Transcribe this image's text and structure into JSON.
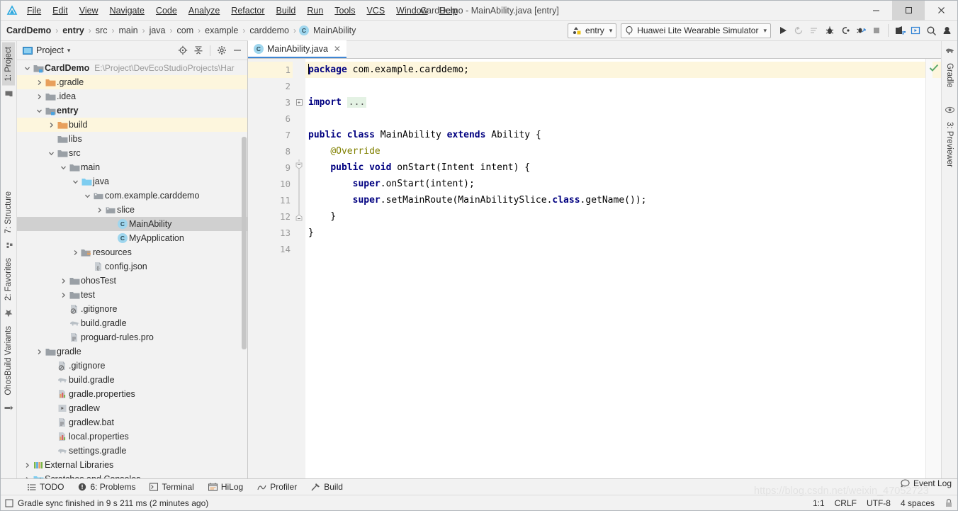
{
  "window": {
    "title": "CardDemo - MainAbility.java [entry]",
    "minimize": "—",
    "maximize": "☐",
    "close": "✕"
  },
  "menubar": [
    {
      "label": "File"
    },
    {
      "label": "Edit"
    },
    {
      "label": "View"
    },
    {
      "label": "Navigate"
    },
    {
      "label": "Code"
    },
    {
      "label": "Analyze"
    },
    {
      "label": "Refactor"
    },
    {
      "label": "Build"
    },
    {
      "label": "Run"
    },
    {
      "label": "Tools"
    },
    {
      "label": "VCS"
    },
    {
      "label": "Window"
    },
    {
      "label": "Help"
    }
  ],
  "breadcrumb": {
    "items": [
      {
        "label": "CardDemo",
        "bold": true
      },
      {
        "label": "entry",
        "bold": true
      },
      {
        "label": "src",
        "bold": false
      },
      {
        "label": "main",
        "bold": false
      },
      {
        "label": "java",
        "bold": false
      },
      {
        "label": "com",
        "bold": false
      },
      {
        "label": "example",
        "bold": false
      },
      {
        "label": "carddemo",
        "bold": false
      },
      {
        "label": "MainAbility",
        "bold": false,
        "icon": "class-icon",
        "icon_text": "C"
      }
    ],
    "separator": "›"
  },
  "toolbar": {
    "module_selector": "entry",
    "device_selector": "Huawei Lite Wearable Simulator",
    "caret": "▾",
    "buttons": [
      {
        "name": "run-button",
        "title": "Run"
      },
      {
        "name": "rerun-button",
        "title": "Rerun"
      },
      {
        "name": "run-with-coverage-button",
        "title": "Run with Coverage"
      },
      {
        "name": "debug-button",
        "title": "Debug"
      },
      {
        "name": "attach-debugger-button",
        "title": "Attach Debugger"
      },
      {
        "name": "profile-button",
        "title": "Profile"
      },
      {
        "name": "stop-button",
        "title": "Stop"
      },
      {
        "name": "device-manager-button",
        "title": "Device Manager"
      },
      {
        "name": "sdk-manager-button",
        "title": "SDK Manager"
      },
      {
        "name": "search-everywhere-icon",
        "title": "Search Everywhere"
      },
      {
        "name": "account-icon",
        "title": "Account"
      }
    ]
  },
  "left_strip": [
    {
      "label": "1: Project",
      "active": true,
      "icon": "project-folder-icon"
    },
    {
      "label": "7: Structure",
      "active": false,
      "icon": "structure-icon"
    },
    {
      "label": "2: Favorites",
      "active": false,
      "icon": "star-icon"
    },
    {
      "label": "OhosBuild Variants",
      "active": false,
      "icon": "variants-icon"
    }
  ],
  "right_strip": [
    {
      "label": "Gradle",
      "icon": "gradle-elephant-icon"
    },
    {
      "label": "3: Previewer",
      "icon": "eye-icon"
    }
  ],
  "project_panel": {
    "title": "Project",
    "title_caret": "▾",
    "actions": [
      {
        "name": "locate-file-icon",
        "title": "Select Opened File"
      },
      {
        "name": "collapse-all-icon",
        "title": "Collapse All"
      },
      {
        "name": "gear-icon",
        "title": "Settings"
      },
      {
        "name": "hide-panel-icon",
        "title": "Hide"
      }
    ],
    "tree": [
      {
        "indent": 0,
        "arrow": "down",
        "icon": "module-folder-icon",
        "label": "CardDemo",
        "bold": true,
        "subpath": "E:\\Project\\DevEcoStudioProjects\\Har",
        "selected": false,
        "highlight": false
      },
      {
        "indent": 1,
        "arrow": "right",
        "icon": "orange-folder-icon",
        "label": ".gradle",
        "bold": false,
        "subpath": "",
        "selected": false,
        "highlight": true
      },
      {
        "indent": 1,
        "arrow": "right",
        "icon": "gray-folder-icon",
        "label": ".idea",
        "bold": false,
        "subpath": "",
        "selected": false,
        "highlight": false
      },
      {
        "indent": 1,
        "arrow": "down",
        "icon": "module-folder-icon",
        "label": "entry",
        "bold": true,
        "subpath": "",
        "selected": false,
        "highlight": false
      },
      {
        "indent": 2,
        "arrow": "right",
        "icon": "orange-folder-icon",
        "label": "build",
        "bold": false,
        "subpath": "",
        "selected": false,
        "highlight": true
      },
      {
        "indent": 2,
        "arrow": "none",
        "icon": "gray-folder-icon",
        "label": "libs",
        "bold": false,
        "subpath": "",
        "selected": false,
        "highlight": false
      },
      {
        "indent": 2,
        "arrow": "down",
        "icon": "gray-folder-icon",
        "label": "src",
        "bold": false,
        "subpath": "",
        "selected": false,
        "highlight": false
      },
      {
        "indent": 3,
        "arrow": "down",
        "icon": "gray-folder-icon",
        "label": "main",
        "bold": false,
        "subpath": "",
        "selected": false,
        "highlight": false
      },
      {
        "indent": 4,
        "arrow": "down",
        "icon": "blue-source-folder-icon",
        "label": "java",
        "bold": false,
        "subpath": "",
        "selected": false,
        "highlight": false
      },
      {
        "indent": 5,
        "arrow": "down",
        "icon": "package-icon",
        "label": "com.example.carddemo",
        "bold": false,
        "subpath": "",
        "selected": false,
        "highlight": false
      },
      {
        "indent": 6,
        "arrow": "right",
        "icon": "package-icon",
        "label": "slice",
        "bold": false,
        "subpath": "",
        "selected": false,
        "highlight": false
      },
      {
        "indent": 7,
        "arrow": "none",
        "icon": "class-icon",
        "label": "MainAbility",
        "bold": false,
        "subpath": "",
        "selected": true,
        "highlight": false
      },
      {
        "indent": 7,
        "arrow": "none",
        "icon": "class-icon",
        "label": "MyApplication",
        "bold": false,
        "subpath": "",
        "selected": false,
        "highlight": false
      },
      {
        "indent": 4,
        "arrow": "right",
        "icon": "resources-folder-icon",
        "label": "resources",
        "bold": false,
        "subpath": "",
        "selected": false,
        "highlight": false
      },
      {
        "indent": 5,
        "arrow": "none",
        "icon": "json-file-icon",
        "label": "config.json",
        "bold": false,
        "subpath": "",
        "selected": false,
        "highlight": false
      },
      {
        "indent": 3,
        "arrow": "right",
        "icon": "gray-folder-icon",
        "label": "ohosTest",
        "bold": false,
        "subpath": "",
        "selected": false,
        "highlight": false
      },
      {
        "indent": 3,
        "arrow": "right",
        "icon": "gray-folder-icon",
        "label": "test",
        "bold": false,
        "subpath": "",
        "selected": false,
        "highlight": false
      },
      {
        "indent": 3,
        "arrow": "none",
        "icon": "gitignore-file-icon",
        "label": ".gitignore",
        "bold": false,
        "subpath": "",
        "selected": false,
        "highlight": false
      },
      {
        "indent": 3,
        "arrow": "none",
        "icon": "gradle-file-icon",
        "label": "build.gradle",
        "bold": false,
        "subpath": "",
        "selected": false,
        "highlight": false
      },
      {
        "indent": 3,
        "arrow": "none",
        "icon": "text-file-icon",
        "label": "proguard-rules.pro",
        "bold": false,
        "subpath": "",
        "selected": false,
        "highlight": false
      },
      {
        "indent": 1,
        "arrow": "right",
        "icon": "gray-folder-icon",
        "label": "gradle",
        "bold": false,
        "subpath": "",
        "selected": false,
        "highlight": false
      },
      {
        "indent": 2,
        "arrow": "none",
        "icon": "gitignore-file-icon",
        "label": ".gitignore",
        "bold": false,
        "subpath": "",
        "selected": false,
        "highlight": false
      },
      {
        "indent": 2,
        "arrow": "none",
        "icon": "gradle-file-icon",
        "label": "build.gradle",
        "bold": false,
        "subpath": "",
        "selected": false,
        "highlight": false
      },
      {
        "indent": 2,
        "arrow": "none",
        "icon": "properties-file-icon",
        "label": "gradle.properties",
        "bold": false,
        "subpath": "",
        "selected": false,
        "highlight": false
      },
      {
        "indent": 2,
        "arrow": "none",
        "icon": "script-file-icon",
        "label": "gradlew",
        "bold": false,
        "subpath": "",
        "selected": false,
        "highlight": false
      },
      {
        "indent": 2,
        "arrow": "none",
        "icon": "text-file-icon",
        "label": "gradlew.bat",
        "bold": false,
        "subpath": "",
        "selected": false,
        "highlight": false
      },
      {
        "indent": 2,
        "arrow": "none",
        "icon": "properties-file-icon",
        "label": "local.properties",
        "bold": false,
        "subpath": "",
        "selected": false,
        "highlight": false
      },
      {
        "indent": 2,
        "arrow": "none",
        "icon": "gradle-file-icon",
        "label": "settings.gradle",
        "bold": false,
        "subpath": "",
        "selected": false,
        "highlight": false
      },
      {
        "indent": 0,
        "arrow": "right",
        "icon": "libraries-icon",
        "label": "External Libraries",
        "bold": false,
        "subpath": "",
        "selected": false,
        "highlight": false
      },
      {
        "indent": 0,
        "arrow": "right",
        "icon": "scratches-icon",
        "label": "Scratches and Consoles",
        "bold": false,
        "subpath": "",
        "selected": false,
        "highlight": false
      }
    ]
  },
  "editor": {
    "tab": {
      "label": "MainAbility.java",
      "icon_text": "C",
      "close": "✕"
    },
    "lines": [
      {
        "num": "1",
        "current": true,
        "fold": "none",
        "gutter_mark": "none",
        "tokens": [
          {
            "t": "kw",
            "v": "package"
          },
          {
            "t": "pl",
            "v": " com.example.carddemo;"
          }
        ],
        "caret_at_start": true
      },
      {
        "num": "2",
        "current": false,
        "fold": "none",
        "gutter_mark": "none",
        "tokens": []
      },
      {
        "num": "3",
        "current": false,
        "fold": "plus",
        "gutter_mark": "none",
        "tokens": [
          {
            "t": "kw",
            "v": "import"
          },
          {
            "t": "pl",
            "v": " "
          },
          {
            "t": "fold",
            "v": "..."
          }
        ]
      },
      {
        "num": "6",
        "current": false,
        "fold": "none",
        "gutter_mark": "none",
        "tokens": []
      },
      {
        "num": "7",
        "current": false,
        "fold": "none",
        "gutter_mark": "none",
        "tokens": [
          {
            "t": "kw",
            "v": "public class"
          },
          {
            "t": "pl",
            "v": " MainAbility "
          },
          {
            "t": "kw",
            "v": "extends"
          },
          {
            "t": "pl",
            "v": " Ability {"
          }
        ]
      },
      {
        "num": "8",
        "current": false,
        "fold": "none",
        "gutter_mark": "none",
        "tokens": [
          {
            "t": "pl",
            "v": "    "
          },
          {
            "t": "ann",
            "v": "@Override"
          }
        ]
      },
      {
        "num": "9",
        "current": false,
        "fold": "top",
        "gutter_mark": "override",
        "tokens": [
          {
            "t": "pl",
            "v": "    "
          },
          {
            "t": "kw",
            "v": "public void"
          },
          {
            "t": "pl",
            "v": " onStart(Intent intent) {"
          }
        ]
      },
      {
        "num": "10",
        "current": false,
        "fold": "bar",
        "gutter_mark": "none",
        "tokens": [
          {
            "t": "pl",
            "v": "        "
          },
          {
            "t": "kw",
            "v": "super"
          },
          {
            "t": "pl",
            "v": ".onStart(intent);"
          }
        ]
      },
      {
        "num": "11",
        "current": false,
        "fold": "bar",
        "gutter_mark": "none",
        "tokens": [
          {
            "t": "pl",
            "v": "        "
          },
          {
            "t": "kw",
            "v": "super"
          },
          {
            "t": "pl",
            "v": ".setMainRoute(MainAbilitySlice."
          },
          {
            "t": "kw",
            "v": "class"
          },
          {
            "t": "pl",
            "v": ".getName());"
          }
        ]
      },
      {
        "num": "12",
        "current": false,
        "fold": "bottom",
        "gutter_mark": "none",
        "tokens": [
          {
            "t": "pl",
            "v": "    }"
          }
        ]
      },
      {
        "num": "13",
        "current": false,
        "fold": "none",
        "gutter_mark": "none",
        "tokens": [
          {
            "t": "pl",
            "v": "}"
          }
        ]
      },
      {
        "num": "14",
        "current": false,
        "fold": "none",
        "gutter_mark": "none",
        "tokens": []
      }
    ],
    "inspection_status": "ok"
  },
  "bottom_tabs": [
    {
      "label": "TODO",
      "icon": "todo-icon",
      "mnemonic": ""
    },
    {
      "label": "6: Problems",
      "icon": "problems-icon",
      "mnemonic": "6"
    },
    {
      "label": "Terminal",
      "icon": "terminal-icon",
      "mnemonic": ""
    },
    {
      "label": "HiLog",
      "icon": "hilog-icon",
      "mnemonic": ""
    },
    {
      "label": "Profiler",
      "icon": "profiler-icon",
      "mnemonic": ""
    },
    {
      "label": "Build",
      "icon": "build-hammer-icon",
      "mnemonic": ""
    }
  ],
  "statusbar": {
    "message": "Gradle sync finished in 9 s 211 ms (2 minutes ago)",
    "event_log": "Event Log",
    "caret_position": "1:1",
    "line_separator": "CRLF",
    "encoding": "UTF-8",
    "indent": "4 spaces",
    "watermark": "https://blog.csdn.net/weixin_47052723"
  },
  "colors": {
    "accent_blue": "#3e86d4",
    "keyword": "#000080",
    "annotation": "#808000",
    "highlight_line": "#fdf6dd",
    "selection": "#d0d0d0",
    "folder_orange": "#e8a05c",
    "folder_gray": "#9aa0a6",
    "class_badge": "#9fd6ee"
  }
}
